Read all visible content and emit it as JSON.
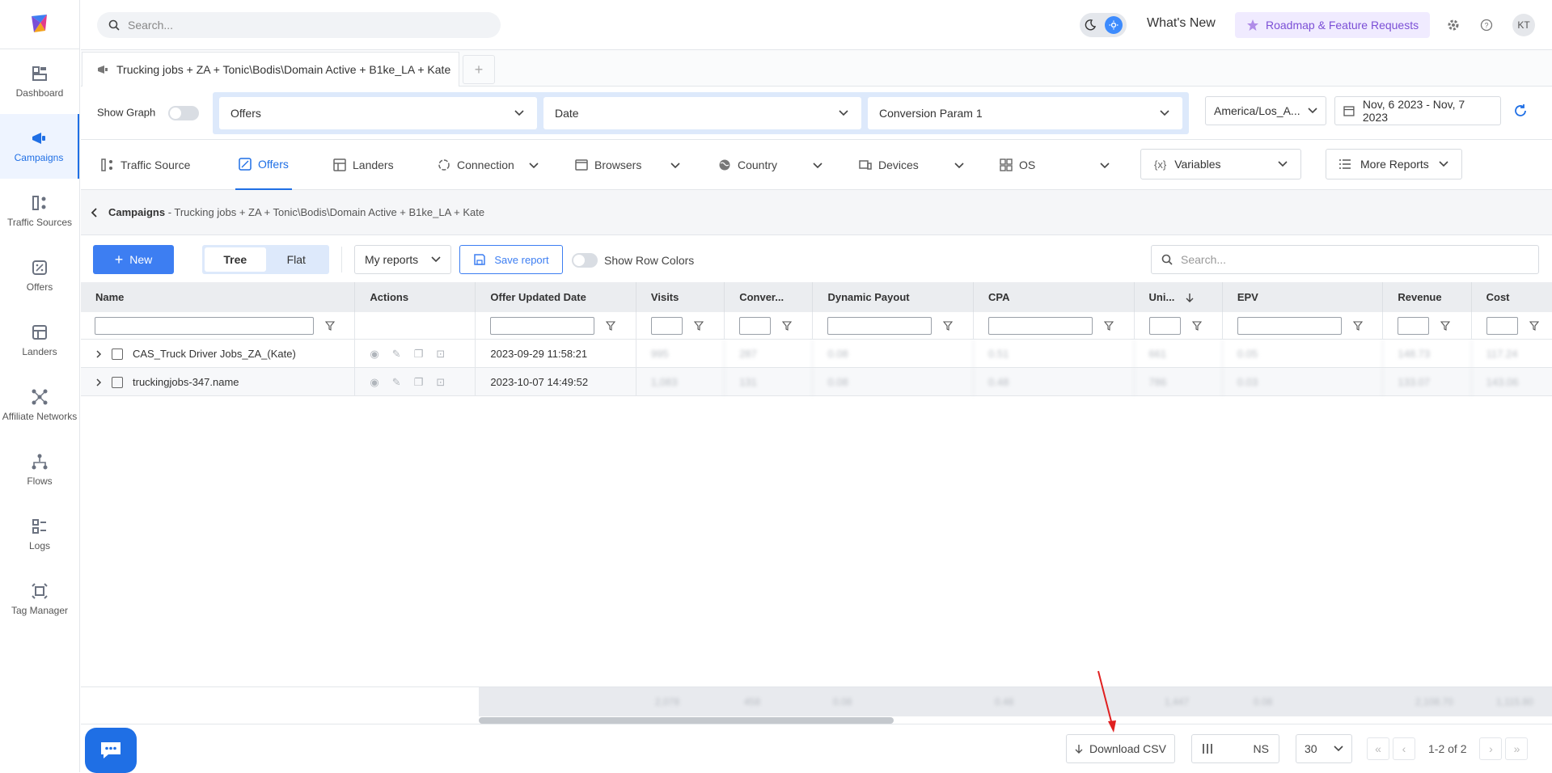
{
  "colors": {
    "accent": "#1f6fe5",
    "primary_button": "#3d7ef2",
    "roadmap_text": "#7b4fd6",
    "arrow": "#e02020"
  },
  "sidebar": {
    "items": [
      {
        "label": "Dashboard",
        "icon": "dashboard-icon"
      },
      {
        "label": "Campaigns",
        "icon": "megaphone-icon",
        "active": true
      },
      {
        "label": "Traffic Sources",
        "icon": "traffic-sources-icon"
      },
      {
        "label": "Offers",
        "icon": "offers-icon"
      },
      {
        "label": "Landers",
        "icon": "landers-icon"
      },
      {
        "label": "Affiliate Networks",
        "icon": "network-icon"
      },
      {
        "label": "Flows",
        "icon": "flows-icon"
      },
      {
        "label": "Logs",
        "icon": "logs-icon"
      },
      {
        "label": "Tag Manager",
        "icon": "tag-manager-icon"
      }
    ]
  },
  "topbar": {
    "search_placeholder": "Search...",
    "whats_new": "What's New",
    "roadmap": "Roadmap & Feature Requests",
    "avatar_initials": "KT"
  },
  "doc_tab": {
    "title": "Trucking jobs + ZA + Tonic\\Bodis\\Domain Active + B1ke_LA + Kate",
    "add": "+"
  },
  "grouping": {
    "show_graph": "Show Graph",
    "group1": "Offers",
    "group2": "Date",
    "group3": "Conversion Param 1",
    "timezone": "America/Los_A...",
    "date_range": "Nov, 6 2023 - Nov, 7 2023"
  },
  "report_tabs": [
    {
      "label": "Traffic Source"
    },
    {
      "label": "Offers",
      "active": true
    },
    {
      "label": "Landers"
    },
    {
      "label": "Connection"
    },
    {
      "label": "Browsers"
    },
    {
      "label": "Country"
    },
    {
      "label": "Devices"
    },
    {
      "label": "OS"
    }
  ],
  "variables": "Variables",
  "more_reports": "More Reports",
  "breadcrumb": {
    "root": "Campaigns",
    "path": " - Trucking jobs + ZA + Tonic\\Bodis\\Domain Active + B1ke_LA + Kate"
  },
  "toolbar": {
    "new": "New",
    "tree": "Tree",
    "flat": "Flat",
    "my_reports": "My reports",
    "save_report": "Save report",
    "row_colors": "Show Row Colors",
    "search_placeholder": "Search..."
  },
  "table": {
    "columns": [
      "Name",
      "Actions",
      "Offer Updated Date",
      "Visits",
      "Conver...",
      "Dynamic Payout",
      "CPA",
      "Uni...",
      "EPV",
      "Revenue",
      "Cost"
    ],
    "rows": [
      {
        "name": "CAS_Truck Driver Jobs_ZA_(Kate)",
        "updated": "2023-09-29 11:58:21",
        "visits": "995",
        "conv": "287",
        "payout": "0.08",
        "cpa": "0.51",
        "uni": "661",
        "epv": "0.05",
        "revenue": "148.73",
        "cost": "117.24"
      },
      {
        "name": "truckingjobs-347.name",
        "updated": "2023-10-07 14:49:52",
        "visits": "1,083",
        "conv": "131",
        "payout": "0.08",
        "cpa": "0.48",
        "uni": "786",
        "epv": "0.03",
        "revenue": "133.07",
        "cost": "143.06"
      }
    ],
    "totals": {
      "visits": "2,078",
      "conv": "458",
      "payout": "0.08",
      "cpa": "0.48",
      "uni": "1,447",
      "epv": "0.08",
      "revenue": "2,108.70",
      "cost": "1,115.80"
    }
  },
  "footer": {
    "download_csv": "Download CSV",
    "columns_label": "NS",
    "page_size": "30",
    "page_info": "1-2 of 2"
  }
}
